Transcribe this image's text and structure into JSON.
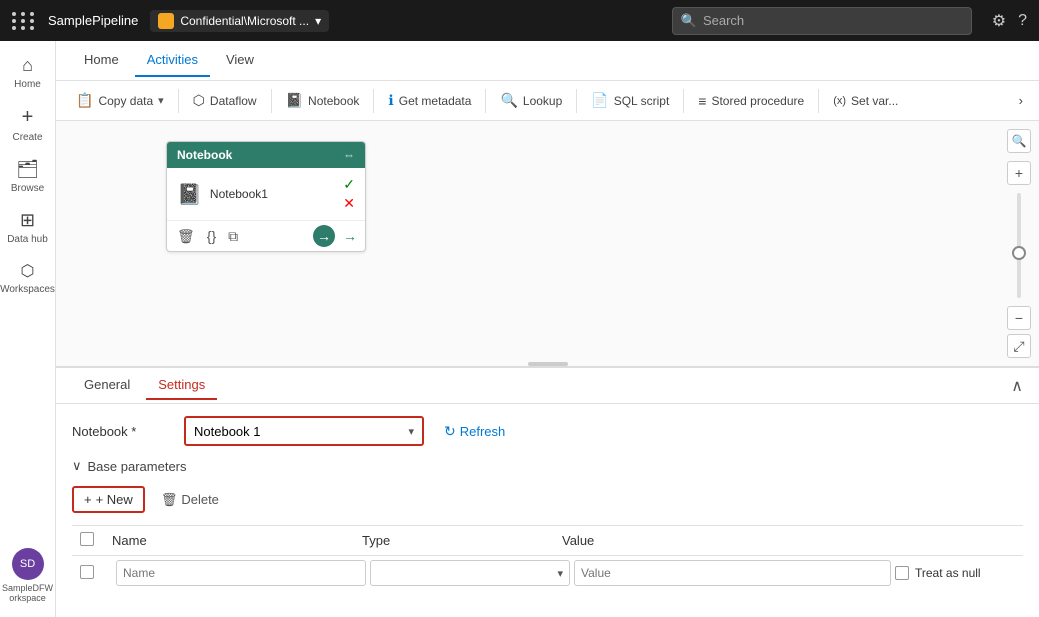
{
  "topbar": {
    "dots": 9,
    "title": "SamplePipeline",
    "workspace_icon": "🟧",
    "workspace_label": "Confidential\\Microsoft ...",
    "workspace_chevron": "▾",
    "search_placeholder": "Search",
    "settings_icon": "⚙",
    "help_icon": "?"
  },
  "sidebar": {
    "items": [
      {
        "id": "home",
        "icon": "⌂",
        "label": "Home"
      },
      {
        "id": "create",
        "icon": "+",
        "label": "Create"
      },
      {
        "id": "browse",
        "icon": "📁",
        "label": "Browse"
      },
      {
        "id": "datahub",
        "icon": "⊞",
        "label": "Data hub"
      },
      {
        "id": "workspaces",
        "icon": "⬡",
        "label": "Workspaces"
      },
      {
        "id": "workspace-name",
        "icon": "⬡",
        "label": "SampleDFWorkspace"
      }
    ]
  },
  "nav_tabs": [
    {
      "id": "home",
      "label": "Home",
      "active": false
    },
    {
      "id": "activities",
      "label": "Activities",
      "active": true
    },
    {
      "id": "view",
      "label": "View",
      "active": false
    }
  ],
  "toolbar": {
    "buttons": [
      {
        "id": "copy-data",
        "icon": "📋",
        "label": "Copy data",
        "has_chevron": true
      },
      {
        "id": "dataflow",
        "icon": "⬡",
        "label": "Dataflow",
        "has_chevron": false
      },
      {
        "id": "notebook",
        "icon": "📓",
        "label": "Notebook",
        "has_chevron": false
      },
      {
        "id": "get-metadata",
        "icon": "ℹ",
        "label": "Get metadata",
        "has_chevron": false
      },
      {
        "id": "lookup",
        "icon": "🔍",
        "label": "Lookup",
        "has_chevron": false
      },
      {
        "id": "sql-script",
        "icon": "📄",
        "label": "SQL script",
        "has_chevron": false
      },
      {
        "id": "stored-procedure",
        "icon": "≡",
        "label": "Stored procedure",
        "has_chevron": false
      },
      {
        "id": "set-var",
        "icon": "(x)",
        "label": "Set var...",
        "has_chevron": false
      }
    ],
    "more_icon": "›"
  },
  "canvas": {
    "node": {
      "title": "Notebook",
      "icon": "📓",
      "label": "Notebook1",
      "has_check": true,
      "has_x": true
    }
  },
  "bottom_panel": {
    "tabs": [
      {
        "id": "general",
        "label": "General",
        "active": false
      },
      {
        "id": "settings",
        "label": "Settings",
        "active": true
      }
    ],
    "collapse_icon": "∧",
    "settings": {
      "notebook_label": "Notebook *",
      "notebook_value": "Notebook 1",
      "refresh_label": "Refresh",
      "base_params_label": "Base parameters",
      "new_label": "+ New",
      "delete_label": "Delete",
      "table": {
        "headers": [
          "",
          "Name",
          "Type",
          "Value",
          ""
        ],
        "row": {
          "name_placeholder": "Name",
          "type_placeholder": "",
          "value_placeholder": "Value",
          "treat_null_label": "Treat as null"
        }
      }
    }
  }
}
